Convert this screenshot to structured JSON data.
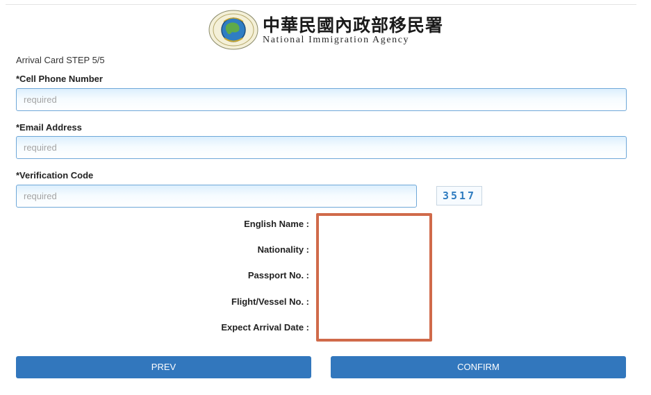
{
  "header": {
    "agency_name_zh": "中華民國內政部移民署",
    "agency_name_en": "National Immigration Agency"
  },
  "step_label": "Arrival Card STEP 5/5",
  "form": {
    "cell_phone": {
      "label": "*Cell Phone Number",
      "placeholder": "required",
      "value": ""
    },
    "email": {
      "label": "*Email Address",
      "placeholder": "required",
      "value": ""
    },
    "verification": {
      "label": "*Verification Code",
      "placeholder": "required",
      "value": "",
      "captcha_text": "3517"
    }
  },
  "summary": [
    {
      "label": "English Name :",
      "value": ""
    },
    {
      "label": "Nationality :",
      "value": ""
    },
    {
      "label": "Passport No. :",
      "value": ""
    },
    {
      "label": "Flight/Vessel No. :",
      "value": ""
    },
    {
      "label": "Expect Arrival Date :",
      "value": ""
    }
  ],
  "buttons": {
    "prev": "PREV",
    "confirm": "CONFIRM"
  },
  "colors": {
    "button_bg": "#3277bd",
    "input_border": "#6ea7d8",
    "highlight_border": "#d06a4a",
    "captcha_text": "#2f7cc0"
  },
  "icons": {
    "logo": "national-immigration-agency-emblem"
  }
}
